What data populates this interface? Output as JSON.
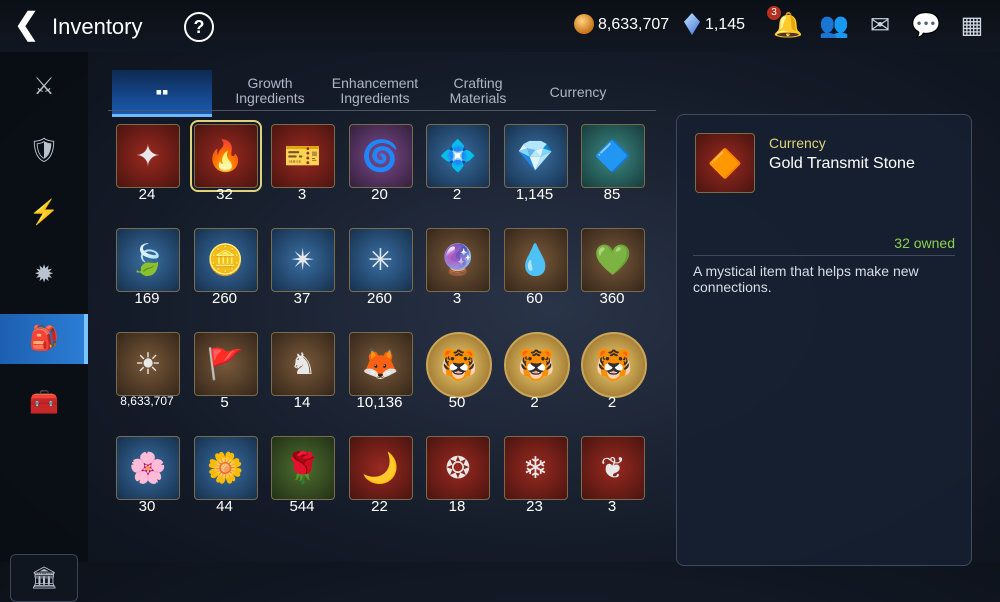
{
  "header": {
    "title": "Inventory",
    "back_icon": "chevron-left-icon",
    "help_label": "?",
    "gold": "8,633,707",
    "crystals": "1,145",
    "notification_count": "3"
  },
  "sidebar": {
    "items": [
      {
        "icon": "sword-shield-icon",
        "glyph": "⚔"
      },
      {
        "icon": "shield-icon",
        "glyph": "🛡"
      },
      {
        "icon": "lightning-icon",
        "glyph": "⚡"
      },
      {
        "icon": "spiky-icon",
        "glyph": "✹"
      },
      {
        "icon": "bag-icon",
        "glyph": "🎒",
        "active": true
      },
      {
        "icon": "chest-icon",
        "glyph": "🧰"
      }
    ],
    "bottom_icon": "house-icon"
  },
  "tabs": [
    {
      "label": "",
      "icon": "grid-icon",
      "active": true
    },
    {
      "label": "Growth Ingredients"
    },
    {
      "label": "Enhancement Ingredients"
    },
    {
      "label": "Crafting Materials"
    },
    {
      "label": "Currency"
    }
  ],
  "items": [
    {
      "count": "24",
      "color": "red"
    },
    {
      "count": "32",
      "color": "red",
      "selected": true
    },
    {
      "count": "3",
      "color": "red"
    },
    {
      "count": "20",
      "color": "purple"
    },
    {
      "count": "2",
      "color": "blue"
    },
    {
      "count": "1,145",
      "color": "blue"
    },
    {
      "count": "85",
      "color": "teal"
    },
    {
      "count": "169",
      "color": "blue"
    },
    {
      "count": "260",
      "color": "blue"
    },
    {
      "count": "37",
      "color": "blue"
    },
    {
      "count": "260",
      "color": "blue"
    },
    {
      "count": "3",
      "color": "brown"
    },
    {
      "count": "60",
      "color": "brown"
    },
    {
      "count": "360",
      "color": "brown"
    },
    {
      "count": "8,633,707",
      "color": "brown",
      "small": true
    },
    {
      "count": "5",
      "color": "brown"
    },
    {
      "count": "14",
      "color": "brown"
    },
    {
      "count": "10,136",
      "color": "brown"
    },
    {
      "count": "50",
      "color": "round"
    },
    {
      "count": "2",
      "color": "round"
    },
    {
      "count": "2",
      "color": "round"
    },
    {
      "count": "30",
      "color": "blue"
    },
    {
      "count": "44",
      "color": "blue"
    },
    {
      "count": "544",
      "color": "green"
    },
    {
      "count": "22",
      "color": "red"
    },
    {
      "count": "18",
      "color": "red"
    },
    {
      "count": "23",
      "color": "red"
    },
    {
      "count": "3",
      "color": "red"
    }
  ],
  "detail": {
    "category": "Currency",
    "name": "Gold Transmit Stone",
    "owned": "32 owned",
    "description": "A mystical item that helps make new connections."
  }
}
